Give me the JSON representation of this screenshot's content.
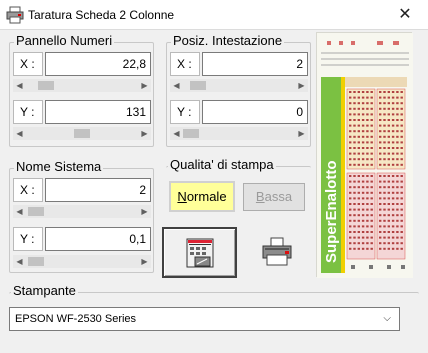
{
  "window": {
    "title": "Taratura Scheda 2 Colonne",
    "close_glyph": "✕"
  },
  "pannello_numeri": {
    "label": "Pannello Numeri",
    "x_label": "X :",
    "x_value": "22,8",
    "x_scroll_fraction": 0.13,
    "y_label": "Y :",
    "y_value": "131",
    "y_scroll_fraction": 0.5
  },
  "posiz_intestazione": {
    "label": "Posiz. Intestazione",
    "x_label": "X :",
    "x_value": "2",
    "x_scroll_fraction": 0.07,
    "y_label": "Y :",
    "y_value": "0",
    "y_scroll_fraction": 0.0
  },
  "nome_sistema": {
    "label": "Nome Sistema",
    "x_label": "X :",
    "x_value": "2",
    "x_scroll_fraction": 0.02,
    "y_label": "Y :",
    "y_value": "0,1",
    "y_scroll_fraction": 0.02
  },
  "qualita_stampa": {
    "label": "Qualita' di stampa",
    "normale_mnemonic": "N",
    "normale_rest": "ormale",
    "bassa_mnemonic": "B",
    "bassa_rest": "assa"
  },
  "stampante": {
    "label": "Stampante",
    "selected": "EPSON WF-2530 Series"
  },
  "ticket": {
    "brand": "SuperEnalotto"
  },
  "colors": {
    "normale_bg": "#ffff99",
    "ticket_green": "#7bc142",
    "ticket_red": "#d9534f"
  }
}
